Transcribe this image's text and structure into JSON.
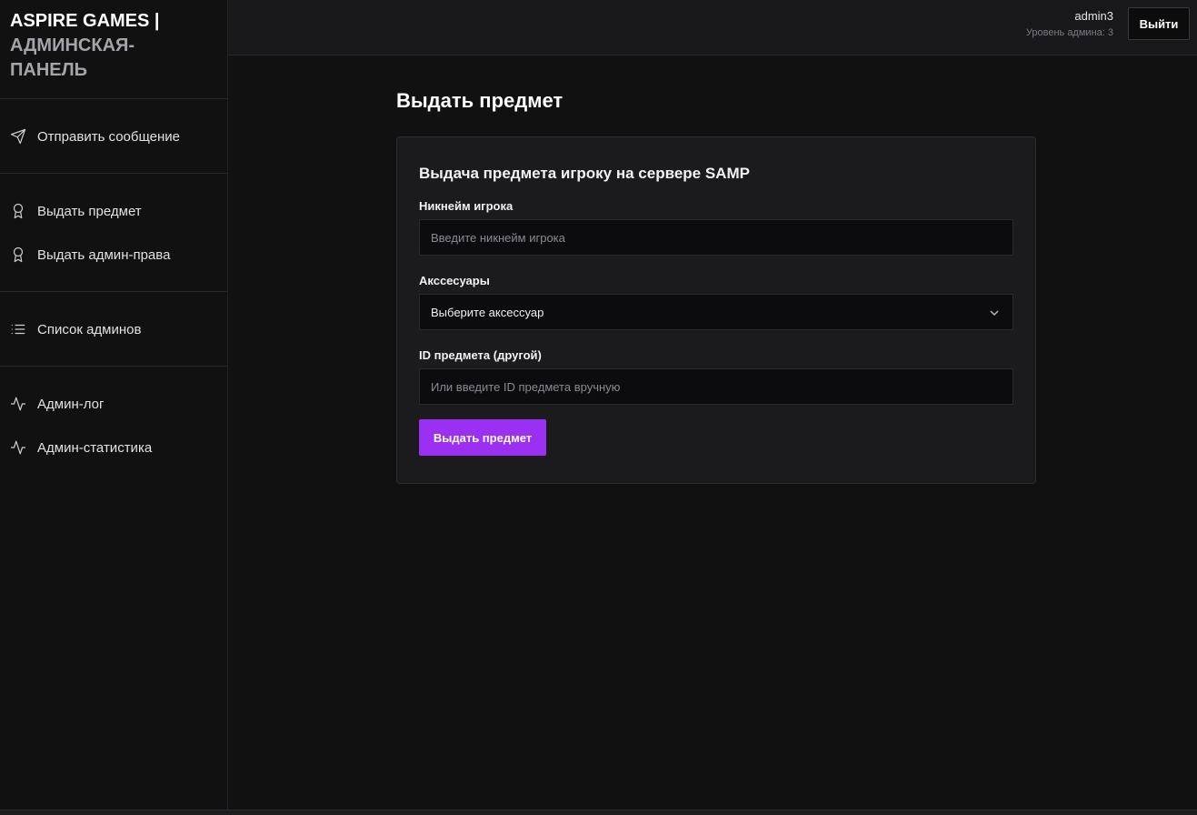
{
  "brand": {
    "main": "ASPIRE GAMES |",
    "sub_line1": "АДМИНСКАЯ-",
    "sub_line2": "ПАНЕЛЬ"
  },
  "sidebar": {
    "groups": [
      {
        "items": [
          {
            "label": "Отправить сообщение",
            "icon": "send-icon"
          }
        ]
      },
      {
        "items": [
          {
            "label": "Выдать предмет",
            "icon": "award-icon"
          },
          {
            "label": "Выдать админ-права",
            "icon": "award-icon"
          }
        ]
      },
      {
        "items": [
          {
            "label": "Список админов",
            "icon": "list-icon"
          }
        ]
      },
      {
        "items": [
          {
            "label": "Админ-лог",
            "icon": "activity-icon"
          },
          {
            "label": "Админ-статистика",
            "icon": "activity-icon"
          }
        ]
      }
    ]
  },
  "header": {
    "username": "admin3",
    "level": "Уровень админа: 3",
    "logout_label": "Выйти"
  },
  "main": {
    "page_title": "Выдать предмет",
    "card": {
      "title": "Выдача предмета игроку на сервере SAMP",
      "nickname": {
        "label": "Никнейм игрока",
        "placeholder": "Введите никнейм игрока",
        "value": ""
      },
      "accessory": {
        "label": "Акссесуары",
        "selected": "Выберите аксессуар"
      },
      "item_id": {
        "label": "ID предмета (другой)",
        "placeholder": "Или введите ID предмета вручную",
        "value": ""
      },
      "submit_label": "Выдать предмет"
    }
  },
  "colors": {
    "accent": "#9b2ff2",
    "background": "#111112",
    "card": "#1b1b1d"
  }
}
